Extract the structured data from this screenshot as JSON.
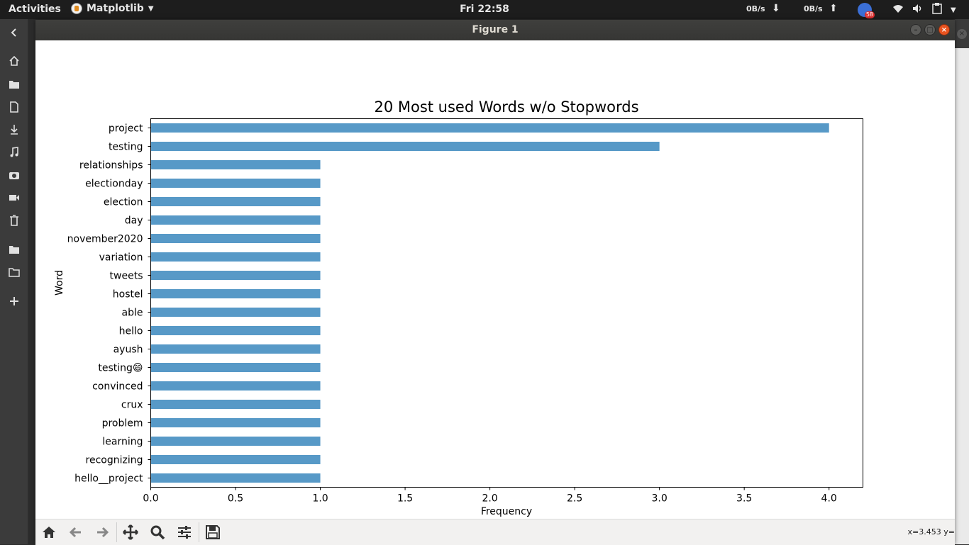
{
  "topbar": {
    "activities": "Activities",
    "app_name": "Matplotlib",
    "clock": "Fri 22:58",
    "net_down": "0B/s",
    "net_up": "0B/s",
    "notification_count": "58"
  },
  "window": {
    "title": "Figure 1"
  },
  "toolbar": {
    "coords": "x=3.453 y="
  },
  "chart_data": {
    "type": "bar",
    "orientation": "horizontal",
    "title": "20 Most used Words w/o Stopwords",
    "xlabel": "Frequency",
    "ylabel": "Word",
    "categories": [
      "project",
      "testing",
      "relationships",
      "electionday",
      "election",
      "day",
      "november2020",
      "variation",
      "tweets",
      "hostel",
      "able",
      "hello",
      "ayush",
      "testing😄",
      "convinced",
      "crux",
      "problem",
      "learning",
      "recognizing",
      "hello__project"
    ],
    "values": [
      4,
      3,
      1,
      1,
      1,
      1,
      1,
      1,
      1,
      1,
      1,
      1,
      1,
      1,
      1,
      1,
      1,
      1,
      1,
      1
    ],
    "xlim": [
      0,
      4.2
    ],
    "xticks": [
      "0.0",
      "0.5",
      "1.0",
      "1.5",
      "2.0",
      "2.5",
      "3.0",
      "3.5",
      "4.0"
    ],
    "bar_color": "#5799c7",
    "grid": false
  }
}
